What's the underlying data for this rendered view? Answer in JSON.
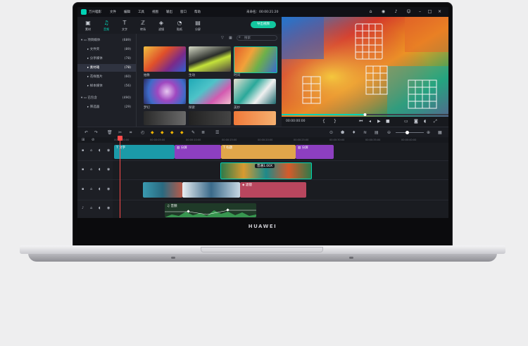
{
  "app": {
    "name": "万兴喵影",
    "menus": [
      "文件",
      "编辑",
      "工具",
      "视图",
      "输出",
      "窗口",
      "帮助"
    ],
    "project_title": "未命名：00:00:21:20",
    "export_label": "导出视频"
  },
  "toolbar": {
    "tabs": [
      {
        "label": "素材",
        "icon": "folder-icon"
      },
      {
        "label": "音频",
        "icon": "music-icon"
      },
      {
        "label": "文字",
        "icon": "text-icon"
      },
      {
        "label": "转场",
        "icon": "transition-icon"
      },
      {
        "label": "滤镜",
        "icon": "filter-icon"
      },
      {
        "label": "贴纸",
        "icon": "sticker-icon"
      },
      {
        "label": "分屏",
        "icon": "splitscreen-icon"
      }
    ],
    "active_tab": "音频"
  },
  "library": {
    "items": [
      {
        "label": "项目媒体",
        "count": "(689)"
      },
      {
        "label": "文件夹",
        "count": "(89)"
      },
      {
        "label": "分享媒体",
        "count": "(78)"
      },
      {
        "label": "素材箱",
        "count": "(78)",
        "selected": true
      },
      {
        "label": "花样图片",
        "count": "(60)"
      },
      {
        "label": "样本媒体",
        "count": "(56)"
      },
      {
        "label": "已包含",
        "count": "(490)"
      },
      {
        "label": "筛选器",
        "count": "(29)"
      }
    ]
  },
  "media": {
    "search_placeholder": "搜索",
    "thumbnails": [
      {
        "label": "抽象"
      },
      {
        "label": "生动"
      },
      {
        "label": "时间"
      },
      {
        "label": "梦幻"
      },
      {
        "label": "探索"
      },
      {
        "label": "美妙"
      }
    ]
  },
  "preview": {
    "timecode": "00:00:00:00",
    "progress": 0.5
  },
  "timeline": {
    "ruler": [
      "00:00:00:00",
      "00:00:05:00",
      "00:00:10:00",
      "00:00:15:00",
      "00:00:20:00",
      "00:00:25:00",
      "00:00:30:00",
      "00:00:35:00",
      "00:00:40:00"
    ],
    "clips": {
      "text": "文字",
      "split1": "分屏",
      "title": "标题",
      "split2": "分屏",
      "speed": "普通1.00X",
      "filter": "滤镜",
      "audio": "音频"
    }
  },
  "device": {
    "brand": "HUAWEI"
  },
  "colors": {
    "accent": "#00d2b4",
    "export": "#12c79f",
    "playhead": "#ff4a4a",
    "text_clip": "#1b9aa8",
    "split_clip": "#8d3fc0",
    "title_clip": "#e0a64a",
    "filter_clip": "#b8465e",
    "audio_clip": "#2e5e3a"
  }
}
